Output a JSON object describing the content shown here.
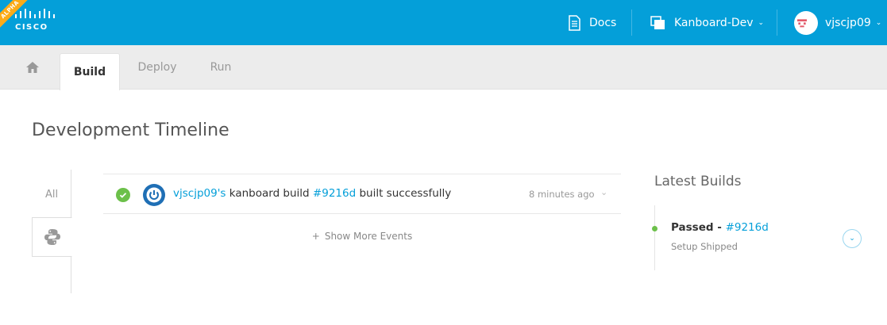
{
  "header": {
    "logo_text": "CISCO",
    "ribbon": "ALPHA",
    "docs_label": "Docs",
    "project_label": "Kanboard-Dev",
    "user_label": "vjscjp09",
    "icons": {
      "docs": "document-icon",
      "project": "stack-icon",
      "chevron": "chevron-down-icon"
    }
  },
  "tabs": {
    "home_icon": "home-icon",
    "build": "Build",
    "deploy": "Deploy",
    "run": "Run"
  },
  "page": {
    "title": "Development Timeline",
    "filters": {
      "all": "All",
      "python_icon": "python-icon"
    }
  },
  "events": [
    {
      "status_icon": "check-icon",
      "user": "vjscjp09's",
      "text_mid": " kanboard build ",
      "build_id": "#9216d",
      "text_end": " built successfully",
      "time": "8 minutes ago"
    }
  ],
  "show_more": "Show More Events",
  "latest": {
    "title": "Latest Builds",
    "builds": [
      {
        "status": "Passed",
        "sep": " - ",
        "id": "#9216d",
        "sub": "Setup Shipped"
      }
    ]
  },
  "colors": {
    "brand": "#049fd9",
    "success": "#6cc04a",
    "ribbon": "#fbab18"
  }
}
